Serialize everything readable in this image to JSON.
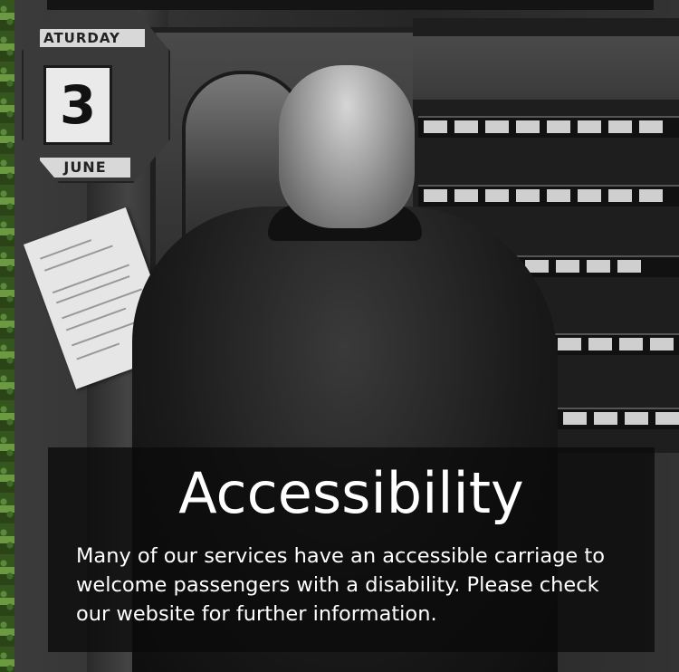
{
  "date_display": {
    "day": "ATURDAY",
    "date": "3",
    "month": "JUNE"
  },
  "caption": {
    "title": "Accessibility",
    "body": "Many of our services have an accessible carriage to welcome passengers with a disability. Please check our website for further information."
  },
  "colors": {
    "caption_background": "#0a0a0a",
    "caption_text": "#ffffff",
    "hedge_green": "#5d8a3a"
  }
}
